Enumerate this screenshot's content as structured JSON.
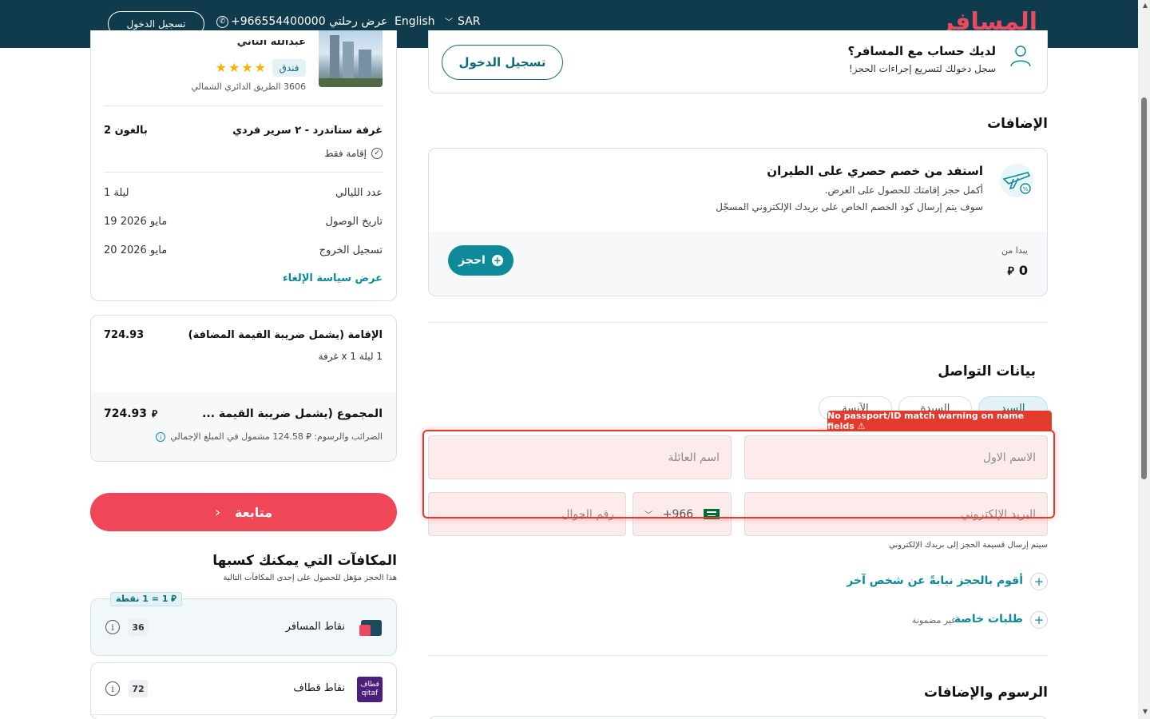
{
  "header": {
    "logo_main": "المسافر",
    "currency": "SAR",
    "language": "English",
    "my_trip": "عرض رحلتي",
    "phone": "+966554400000",
    "login": "تسجيل الدخول"
  },
  "account_prompt": {
    "title": "لديك حساب مع المسافر؟",
    "subtitle": "سجل دخولك لتسريع إجراءات الحجز!",
    "button": "تسجيل الدخول"
  },
  "addons": {
    "heading": "الإضافات",
    "offer_title": "استفد من خصم حصري على الطيران",
    "offer_line1": "أكمل حجز إقامتك للحصول على العرض.",
    "offer_line2": "سوف يتم إرسال كود الخصم الخاص على بريدك الإلكتروني المسجّل",
    "starts_from": "يبدا من",
    "price": "0",
    "currency_symbol": "⃁",
    "book_button": "احجز"
  },
  "contact": {
    "heading": "بيانات التواصل",
    "tabs": [
      "السيد",
      "السيدة",
      "الآنسة"
    ],
    "warning": "No passport/ID match warning on name fields ⚠",
    "first_name_placeholder": "الاسم الاول",
    "last_name_placeholder": "اسم العائلة",
    "email_placeholder": "البريد الإلكتروني",
    "country_code": "+966",
    "phone_placeholder": "رقم الجوال",
    "email_note": "سيتم إرسال قسيمة الحجز إلى بريدك الإلكتروني",
    "book_for_other": "أقوم بالحجز نيابةً عن شخص آخر",
    "special_requests": "طلبات خاصة",
    "not_guaranteed": "غير مضمونة"
  },
  "fees_heading": "الرسوم والإضافات",
  "hotel": {
    "name": "عبدالله الثاني",
    "type": "فندق",
    "stars": "★★★★",
    "address": "3606 الطريق الدائري الشمالي",
    "room": "غرفة ستاندرد - ٢ سرير فردي",
    "guests": "2 بالغون",
    "board": "إقامة فقط",
    "nights_label": "عدد الليالي",
    "nights_value": "1 ليلة",
    "checkin_label": "تاريخ الوصول",
    "checkin_value": "19 مايو 2026",
    "checkout_label": "تسجيل الخروج",
    "checkout_value": "20 مايو 2026",
    "cancel_policy": "عرض سياسة الإلغاء"
  },
  "pricing": {
    "stay_label": "الإقامة (يشمل ضريبة القيمة المضافة)",
    "stay_value": "724.93",
    "stay_detail": "1 ليلة x 1 غرفة",
    "total_label": "المجموع (يشمل ضريبة القيمة ...",
    "total_value": "724.93",
    "currency_symbol": "⃁",
    "tax_note": "الضرائب والرسوم: ⃁ 124.58 مشمول في المبلغ الإجمالي"
  },
  "continue_button": "متابعة",
  "rewards": {
    "heading": "المكافآت التي يمكنك كسبها",
    "subheading": "هذا الحجز مؤهل للحصول على إحدى المكافآت التالية",
    "rate_tag": "⃁ 1 = 1 نقطة",
    "items": [
      {
        "name": "نقاط المسافر",
        "points": "36"
      },
      {
        "name": "نقاط قطاف",
        "points": "72",
        "logo_text": "قطاف qitaf"
      }
    ]
  },
  "colors": {
    "header_bg": "#0f3b4c",
    "teal": "#0e8a9a",
    "red": "#ef4757",
    "warning": "#e23b2e"
  }
}
